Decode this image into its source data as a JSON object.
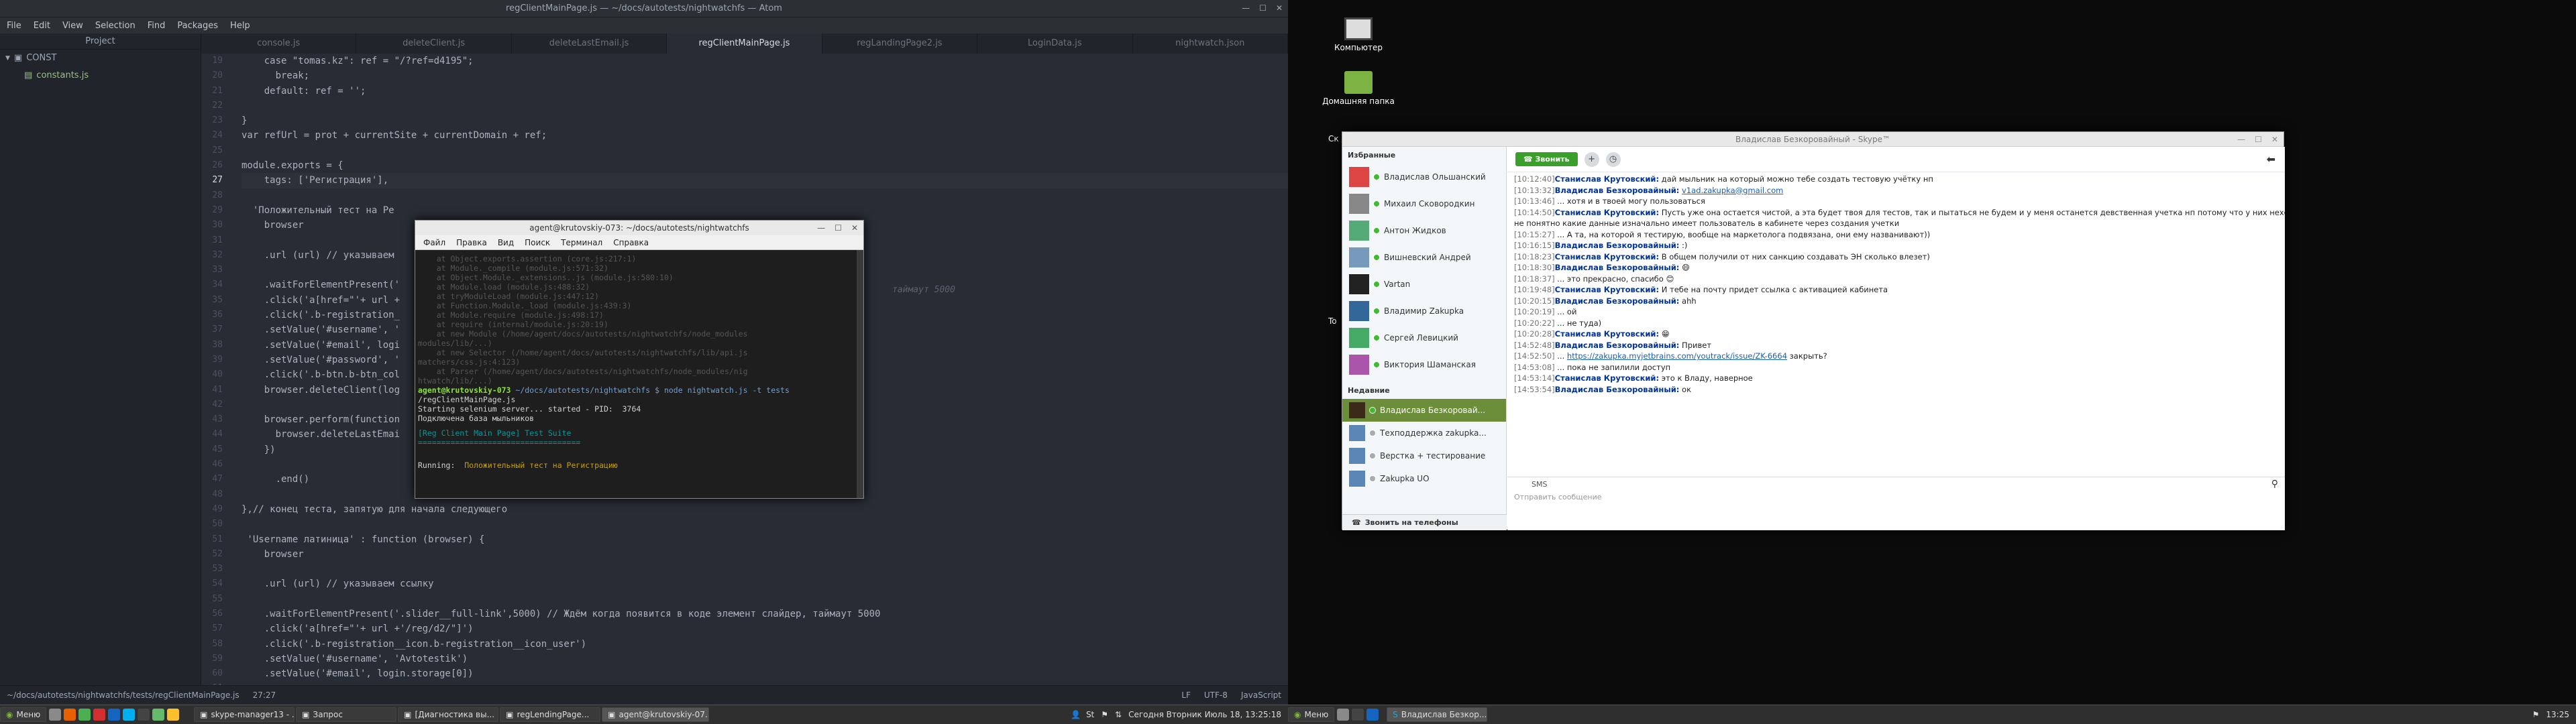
{
  "atom": {
    "title": "regClientMainPage.js — ~/docs/autotests/nightwatchfs — Atom",
    "menu": [
      "File",
      "Edit",
      "View",
      "Selection",
      "Find",
      "Packages",
      "Help"
    ],
    "tree_header": "Project",
    "tree_folder": "CONST",
    "tree_file": "constants.js",
    "tabs": [
      "console.js",
      "deleteClient.js",
      "deleteLastEmail.js",
      "regClientMainPage.js",
      "regLandingPage2.js",
      "LoginData.js",
      "nightwatch.json"
    ],
    "active_tab_index": 3,
    "line_numbers": [
      "19",
      "20",
      "21",
      "22",
      "23",
      "24",
      "25",
      "26",
      "27",
      "28",
      "29",
      "30",
      "31",
      "32",
      "33",
      "34",
      "35",
      "36",
      "37",
      "38",
      "39",
      "40",
      "41",
      "42",
      "43",
      "44",
      "45",
      "46",
      "47",
      "48",
      "49",
      "50",
      "51",
      "52",
      "53",
      "54",
      "55",
      "56",
      "57",
      "58",
      "59",
      "60",
      "61"
    ],
    "current_line_index": 8,
    "code_lines": [
      "    case \"tomas.kz\": ref = \"/?ref=d4195\";",
      "      break;",
      "    default: ref = '';",
      "",
      "}",
      "var refUrl = prot + currentSite + currentDomain + ref;",
      "",
      "module.exports = {",
      "    tags: ['Регистрация'],",
      "",
      "  'Положительный тест на Ре",
      "    browser",
      "",
      "    .url (url) // указываем",
      "",
      "    .waitForElementPresent('",
      "    .click('a[href=\"'+ url +",
      "    .click('.b-registration_",
      "    .setValue('#username', '",
      "    .setValue('#email', logi",
      "    .setValue('#password', '",
      "    .click('.b-btn.b-btn_col",
      "    browser.deleteClient(log",
      "",
      "    browser.perform(function",
      "      browser.deleteLastEmai",
      "    })",
      "",
      "      .end()",
      "",
      "},// конец теста, запятую для начала следующего",
      "",
      " 'Username латиница' : function (browser) {",
      "    browser",
      "",
      "    .url (url) // указываем ссылку",
      "",
      "    .waitForElementPresent('.slider__full-link',5000) // Ждём когда появится в коде элемент слайдер, таймаут 5000",
      "    .click('a[href=\"'+ url +'/reg/d2/\"]')",
      "    .click('.b-registration__icon.b-registration__icon_user')",
      "    .setValue('#username', 'Avtotestik')",
      "    .setValue('#email', login.storage[0])",
      ""
    ],
    "timeout_fragment": "таймаут 5000",
    "status_left": "~/docs/autotests/nightwatchfs/tests/regClientMainPage.js",
    "status_pos": "27:27",
    "status_right": [
      "LF",
      "UTF-8",
      "JavaScript"
    ]
  },
  "terminal": {
    "title": "agent@krutovskiy-073: ~/docs/autotests/nightwatchfs",
    "menu": [
      "Файл",
      "Правка",
      "Вид",
      "Поиск",
      "Терминал",
      "Справка"
    ],
    "dim_lines": [
      "    at Object.exports.assertion (core.js:217:1)",
      "    at Module._compile (module.js:571:32)",
      "    at Object.Module._extensions..js (module.js:580:10)",
      "    at Module.load (module.js:488:32)",
      "    at tryModuleLoad (module.js:447:12)",
      "    at Function.Module._load (module.js:439:3)",
      "    at Module.require (module.js:498:17)",
      "    at require (internal/module.js:20:19)",
      "    at new Module (/home/agent/docs/autotests/nightwatchfs/node_modules",
      "modules/lib/...)",
      "    at new Selector (/home/agent/docs/autotests/nightwatchfs/lib/api.js",
      "matchers/css.js:4:123)",
      "    at Parser (/home/agent/docs/autotests/nightwatchfs/node_modules/nig",
      "htwatch/lib/...)"
    ],
    "prompt": "agent@krutovskiy-073",
    "prompt_path": " ~/docs/autotests/nightwatchfs $ node nightwatch.js -t tests",
    "cmd_cont": "/regClientMainPage.js",
    "selenium_line": "Starting selenium server... started - PID:  3764",
    "db_line": "Подключена база мыльников",
    "suite_line": "[Reg Client Main Page] Test Suite",
    "suite_rule": "===================================",
    "running_label": "Running:",
    "running_test": "  Положительный тест на Регистрацию"
  },
  "desktop": {
    "icon_computer": "Компьютер",
    "icon_home": "Домашняя папка",
    "side_labels": [
      "Ск",
      "To"
    ]
  },
  "skype": {
    "title": "Владислав Безкоровайный - Skype™",
    "favorites": "Избранные",
    "fav_contacts": [
      "Владислав Ольшанский",
      "Михаил Сковородкин",
      "Антон Жидков",
      "Вишневский Андрей",
      "Vartan",
      "Владимир Zakupka",
      "Сергей Левицкий",
      "Виктория Шаманская"
    ],
    "recent": "Недавние",
    "recent_contacts": [
      "Владислав Безкоровай...",
      "Техподдержка zakupka...",
      "Верстка + тестирование",
      "Zakupka UO"
    ],
    "call_phones": "Звонить на телефоны",
    "call": "Звонить",
    "messages": [
      {
        "t": "[10:12:40]",
        "a": "Станислав Крутовский:",
        "m": " дай мыльник на который можно тебе создать тестовую учётку нп"
      },
      {
        "t": "[10:13:32]",
        "a": "Владислав Безкоровайный:",
        "m": " ",
        "l": "v1ad.zakupka@gmail.com"
      },
      {
        "t": "[10:13:46]",
        "a": "",
        "m": " ... хотя и в твоей могу пользоваться"
      },
      {
        "t": "[10:14:50]",
        "a": "Станислав Крутовский:",
        "m": " Пусть уже она остается чистой, а эта будет твоя для тестов, так и пытаться не будем и у меня останется девственная учетка нп потому что у них нехера"
      },
      {
        "t": "",
        "a": "",
        "m": "    не понятно какие данные изначально имеет пользователь в кабинете через создания учетки"
      },
      {
        "t": "[10:15:27]",
        "a": "",
        "m": " ... А та, на которой я тестирую, вообще на маркетолога подвязана, они ему названивают))"
      },
      {
        "t": "[10:16:15]",
        "a": "Владислав Безкоровайный:",
        "m": " :)"
      },
      {
        "t": "[10:18:23]",
        "a": "Станислав Крутовский:",
        "m": " В общем получили от них санкцию создавать ЭН сколько влезет)"
      },
      {
        "t": "[10:18:30]",
        "a": "Владислав Безкоровайный:",
        "m": " 😄"
      },
      {
        "t": "[10:18:37]",
        "a": "",
        "m": " ... это прекрасно, спасибо 😊"
      },
      {
        "t": "[10:19:48]",
        "a": "Станислав Крутовский:",
        "m": " И тебе на почту придет ссылка с активацией кабинета"
      },
      {
        "t": "[10:20:15]",
        "a": "Владислав Безкоровайный:",
        "m": " ahh"
      },
      {
        "t": "[10:20:19]",
        "a": "",
        "m": " ... ой"
      },
      {
        "t": "[10:20:22]",
        "a": "",
        "m": " ... не туда)"
      },
      {
        "t": "[10:20:28]",
        "a": "Станислав Крутовский:",
        "m": " 😁"
      },
      {
        "t": "[14:52:48]",
        "a": "Владислав Безкоровайный:",
        "m": " Привет"
      },
      {
        "t": "[14:52:50]",
        "a": "",
        "m": " ... ",
        "l": "https://zakupka.myjetbrains.com/youtrack/issue/ZK-6664",
        "m2": " закрыть?"
      },
      {
        "t": "[14:53:08]",
        "a": "",
        "m": " ... пока не запилили доступ"
      },
      {
        "t": "[14:53:14]",
        "a": "Станислав Крутовский:",
        "m": " это к Владу, наверное"
      },
      {
        "t": "[14:53:54]",
        "a": "Владислав Безкоровайный:",
        "m": " ок"
      }
    ],
    "sms": "SMS",
    "placeholder": "Отправить сообщение"
  },
  "taskbar_left": {
    "menu": "Меню",
    "windows": [
      "skype-manager13 - ...",
      "Запрос",
      "[Диагностика вы...",
      "regLendingPage...",
      "agent@krutovskiy-07..."
    ],
    "tray_user": "St",
    "clock": "Сегодня Вторник Июль 18, 13:25:18"
  },
  "taskbar_right": {
    "menu": "Меню",
    "window": "Владислав Безкор...",
    "clock": "13:25"
  }
}
